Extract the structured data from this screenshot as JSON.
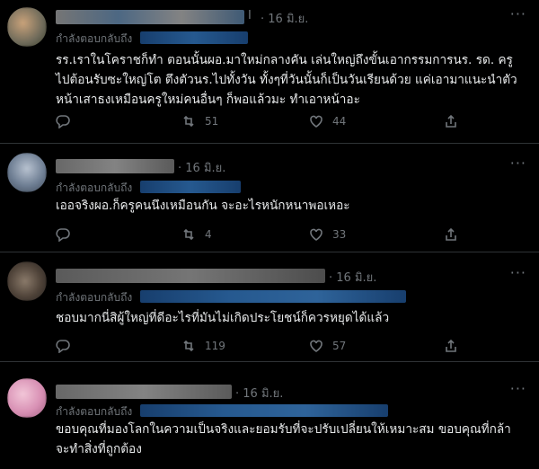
{
  "tweets": [
    {
      "date": "· 16 มิ.ย.",
      "reply_label": "กำลังตอบกลับถึง",
      "text": "รร.เราในโคราชก็ทำ ตอนนั้นผอ.มาใหม่กลางคัน เล่นใหญ่ถึงขั้นเอากรรมการนร. รด. ครู ไปต้อนรับซะใหญ่โต ตึงตัวนร.ไปทั้งวัน ทั้งๆที่วันนั้นก็เป็นวันเรียนด้วย แค่เอามาแนะนำตัวหน้าเสาธงเหมือนครูใหม่คนอื่นๆ ก็พอแล้วมะ ทำเอาหน้าอะ",
      "retweets": "51",
      "likes": "44"
    },
    {
      "date": "· 16 มิ.ย.",
      "reply_label": "กำลังตอบกลับถึง",
      "text": "เออจริงผอ.ก็ครูคนนึงเหมือนกัน จะอะไรหนักหนาพอเหอะ",
      "retweets": "4",
      "likes": "33"
    },
    {
      "date": "· 16 มิ.ย.",
      "reply_label": "กำลังตอบกลับถึง",
      "text": "ชอบมากนี่สิผู้ใหญ่ที่ดีอะไรที่มันไม่เกิดประโยชน์ก็ควรหยุดได้แล้ว",
      "retweets": "119",
      "likes": "57"
    },
    {
      "date": "· 16 มิ.ย.",
      "reply_label": "กำลังตอบกลับถึง",
      "text": "ขอบคุณที่มองโลกในความเป็นจริงและยอมรับที่จะปรับเปลี่ยนให้เหมาะสม ขอบคุณที่กล้าจะทำสิ่งที่ถูกต้อง",
      "retweets": "",
      "likes": ""
    }
  ],
  "more_label": "···",
  "icons": [
    "reply-icon",
    "retweet-icon",
    "like-icon",
    "share-icon",
    "more-icon"
  ]
}
